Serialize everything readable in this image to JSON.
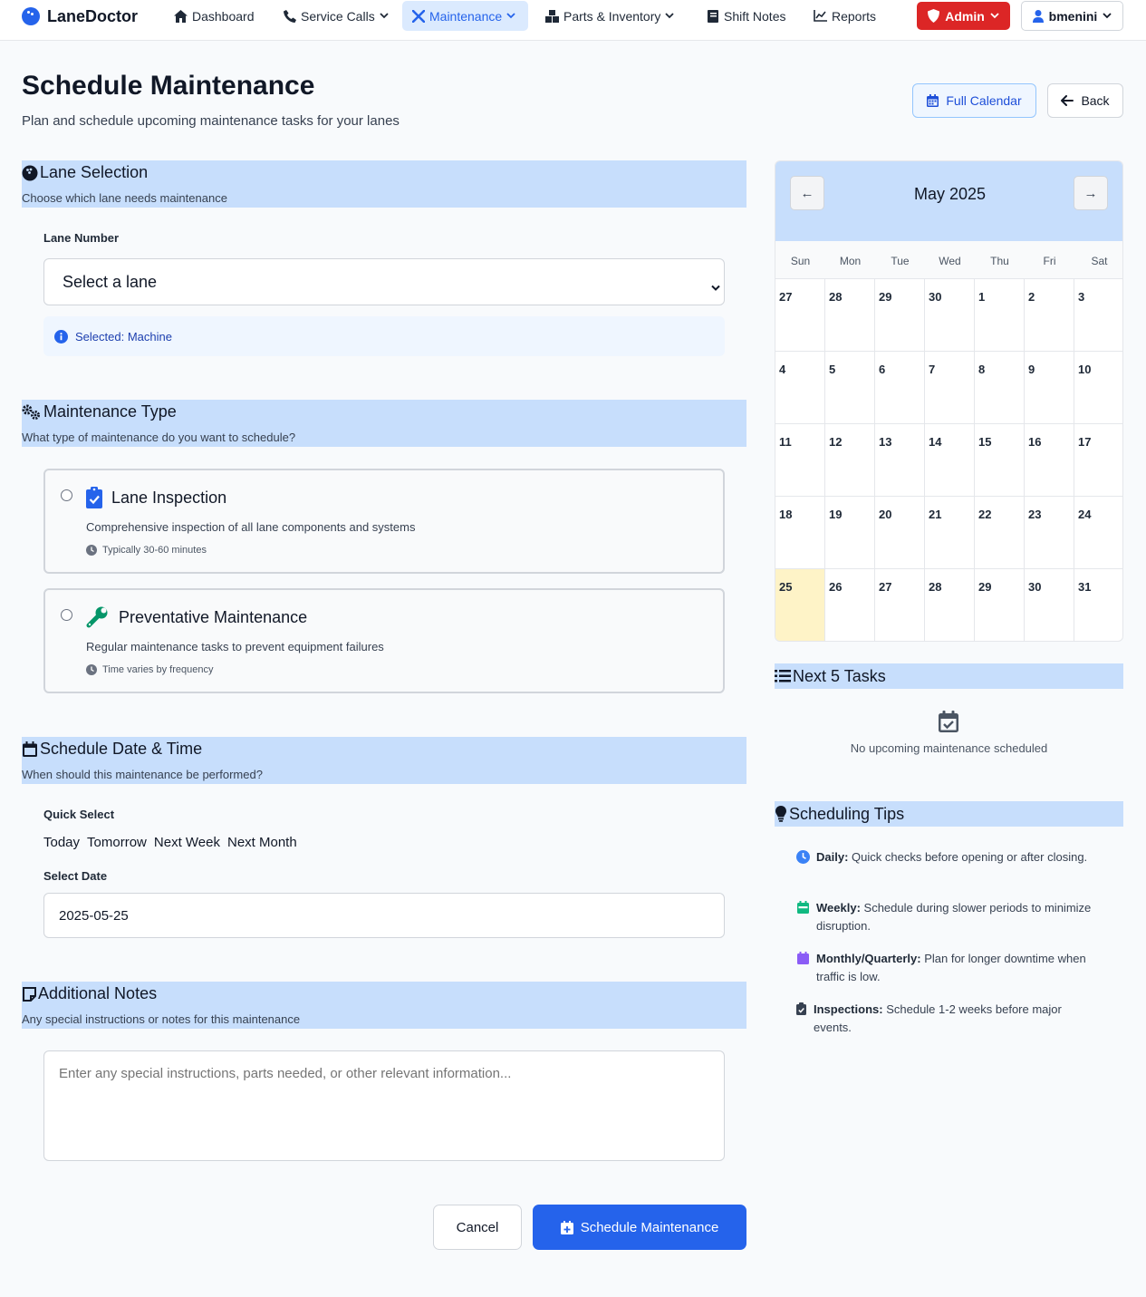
{
  "nav": {
    "brand": "LaneDoctor",
    "items": [
      {
        "label": "Dashboard"
      },
      {
        "label": "Service Calls"
      },
      {
        "label": "Maintenance"
      },
      {
        "label": "Parts & Inventory"
      },
      {
        "label": "Shift Notes"
      },
      {
        "label": "Reports"
      }
    ],
    "admin_label": "Admin",
    "user_label": "bmenini"
  },
  "header": {
    "title": "Schedule Maintenance",
    "subtitle": "Plan and schedule upcoming maintenance tasks for your lanes",
    "full_calendar_label": "Full Calendar",
    "back_label": "Back"
  },
  "lane_selection": {
    "title": "Lane Selection",
    "description": "Choose which lane needs maintenance",
    "field_label": "Lane Number",
    "selected_value": "Select a lane",
    "info_text": "Selected: Machine"
  },
  "maintenance_type": {
    "title": "Maintenance Type",
    "description": "What type of maintenance do you want to schedule?",
    "options": [
      {
        "title": "Lane Inspection",
        "description": "Comprehensive inspection of all lane components and systems",
        "meta": "Typically 30-60 minutes"
      },
      {
        "title": "Preventative Maintenance",
        "description": "Regular maintenance tasks to prevent equipment failures",
        "meta": "Time varies by frequency"
      }
    ]
  },
  "schedule": {
    "title": "Schedule Date & Time",
    "description": "When should this maintenance be performed?",
    "quick_select_label": "Quick Select",
    "quick_options": [
      "Today",
      "Tomorrow",
      "Next Week",
      "Next Month"
    ],
    "date_label": "Select Date",
    "date_value": "2025-05-25"
  },
  "notes": {
    "title": "Additional Notes",
    "description": "Any special instructions or notes for this maintenance",
    "placeholder": "Enter any special instructions, parts needed, or other relevant information..."
  },
  "actions": {
    "cancel_label": "Cancel",
    "submit_label": "Schedule Maintenance"
  },
  "calendar": {
    "month_label": "May 2025",
    "prev_label": "←",
    "next_label": "→",
    "weekdays": [
      "Sun",
      "Mon",
      "Tue",
      "Wed",
      "Thu",
      "Fri",
      "Sat"
    ],
    "weeks": [
      [
        "27",
        "28",
        "29",
        "30",
        "1",
        "2",
        "3"
      ],
      [
        "4",
        "5",
        "6",
        "7",
        "8",
        "9",
        "10"
      ],
      [
        "11",
        "12",
        "13",
        "14",
        "15",
        "16",
        "17"
      ],
      [
        "18",
        "19",
        "20",
        "21",
        "22",
        "23",
        "24"
      ],
      [
        "25",
        "26",
        "27",
        "28",
        "29",
        "30",
        "31"
      ]
    ],
    "highlight_color": "#fef3c7"
  },
  "next_tasks": {
    "title": "Next 5 Tasks",
    "empty_text": "No upcoming maintenance scheduled"
  },
  "tips": {
    "title": "Scheduling Tips",
    "items": [
      {
        "label": "Daily:",
        "text": "Quick checks before opening or after closing.",
        "icon": "clock-icon",
        "color": "#3b82f6"
      },
      {
        "label": "Weekly:",
        "text": "Schedule during slower periods to minimize disruption.",
        "icon": "calendar-week-icon",
        "color": "#10b981"
      },
      {
        "label": "Monthly/Quarterly:",
        "text": "Plan for longer downtime when traffic is low.",
        "icon": "calendar-icon",
        "color": "#8b5cf6"
      },
      {
        "label": "Inspections:",
        "text": "Schedule 1-2 weeks before major events.",
        "icon": "clipboard-icon",
        "color": "#374151"
      }
    ]
  },
  "colors": {
    "accent": "#2563eb",
    "section_header": "#c7defc",
    "admin": "#dc2626"
  }
}
